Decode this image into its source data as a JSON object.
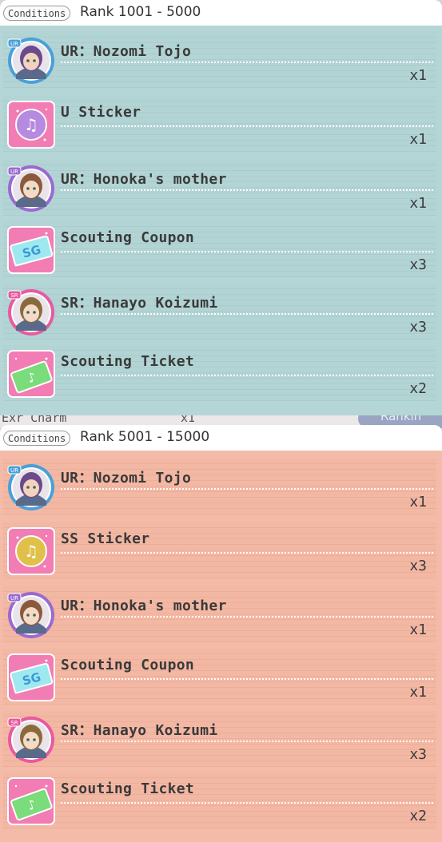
{
  "background": {
    "left_text": "Exr Charm",
    "mid_text": "x1",
    "right_text": "Rankin"
  },
  "panels": [
    {
      "theme": "blue",
      "conditions_label": "Conditions",
      "rank_label": "Rank 1001 - 5000",
      "rows": [
        {
          "name": "UR：Nozomi Tojo",
          "qty": "x1",
          "icon": "nozomi-card-icon",
          "kind": "card",
          "rarity": "UR",
          "frame": "#4aa0d8",
          "hair": "#6a4a8a",
          "skin": "#f3d3c0"
        },
        {
          "name": "U Sticker",
          "qty": "x1",
          "icon": "u-sticker-icon",
          "kind": "sticker",
          "coin": "#b58ae0"
        },
        {
          "name": "UR：Honoka's mother",
          "qty": "x1",
          "icon": "honoka-mother-card-icon",
          "kind": "card",
          "rarity": "UR",
          "frame": "#9a6ad0",
          "hair": "#8a5a3a",
          "skin": "#f5dac8"
        },
        {
          "name": "Scouting Coupon",
          "qty": "x3",
          "icon": "scouting-coupon-icon",
          "kind": "coupon"
        },
        {
          "name": "SR：Hanayo Koizumi",
          "qty": "x3",
          "icon": "hanayo-card-icon",
          "kind": "card",
          "rarity": "SR",
          "frame": "#e85aa0",
          "hair": "#8a6a3a",
          "skin": "#f5dac8"
        },
        {
          "name": "Scouting Ticket",
          "qty": "x2",
          "icon": "scouting-ticket-icon",
          "kind": "ticket"
        }
      ]
    },
    {
      "theme": "red",
      "conditions_label": "Conditions",
      "rank_label": "Rank 5001 - 15000",
      "rows": [
        {
          "name": "UR：Nozomi Tojo",
          "qty": "x1",
          "icon": "nozomi-card-icon",
          "kind": "card",
          "rarity": "UR",
          "frame": "#4aa0d8",
          "hair": "#6a4a8a",
          "skin": "#f3d3c0"
        },
        {
          "name": "SS Sticker",
          "qty": "x3",
          "icon": "ss-sticker-icon",
          "kind": "sticker",
          "coin": "#e0c048"
        },
        {
          "name": "UR：Honoka's mother",
          "qty": "x1",
          "icon": "honoka-mother-card-icon",
          "kind": "card",
          "rarity": "UR",
          "frame": "#9a6ad0",
          "hair": "#8a5a3a",
          "skin": "#f5dac8"
        },
        {
          "name": "Scouting Coupon",
          "qty": "x1",
          "icon": "scouting-coupon-icon",
          "kind": "coupon"
        },
        {
          "name": "SR：Hanayo Koizumi",
          "qty": "x3",
          "icon": "hanayo-card-icon",
          "kind": "card",
          "rarity": "SR",
          "frame": "#e85aa0",
          "hair": "#8a6a3a",
          "skin": "#f5dac8"
        },
        {
          "name": "Scouting Ticket",
          "qty": "x2",
          "icon": "scouting-ticket-icon",
          "kind": "ticket"
        }
      ]
    }
  ]
}
